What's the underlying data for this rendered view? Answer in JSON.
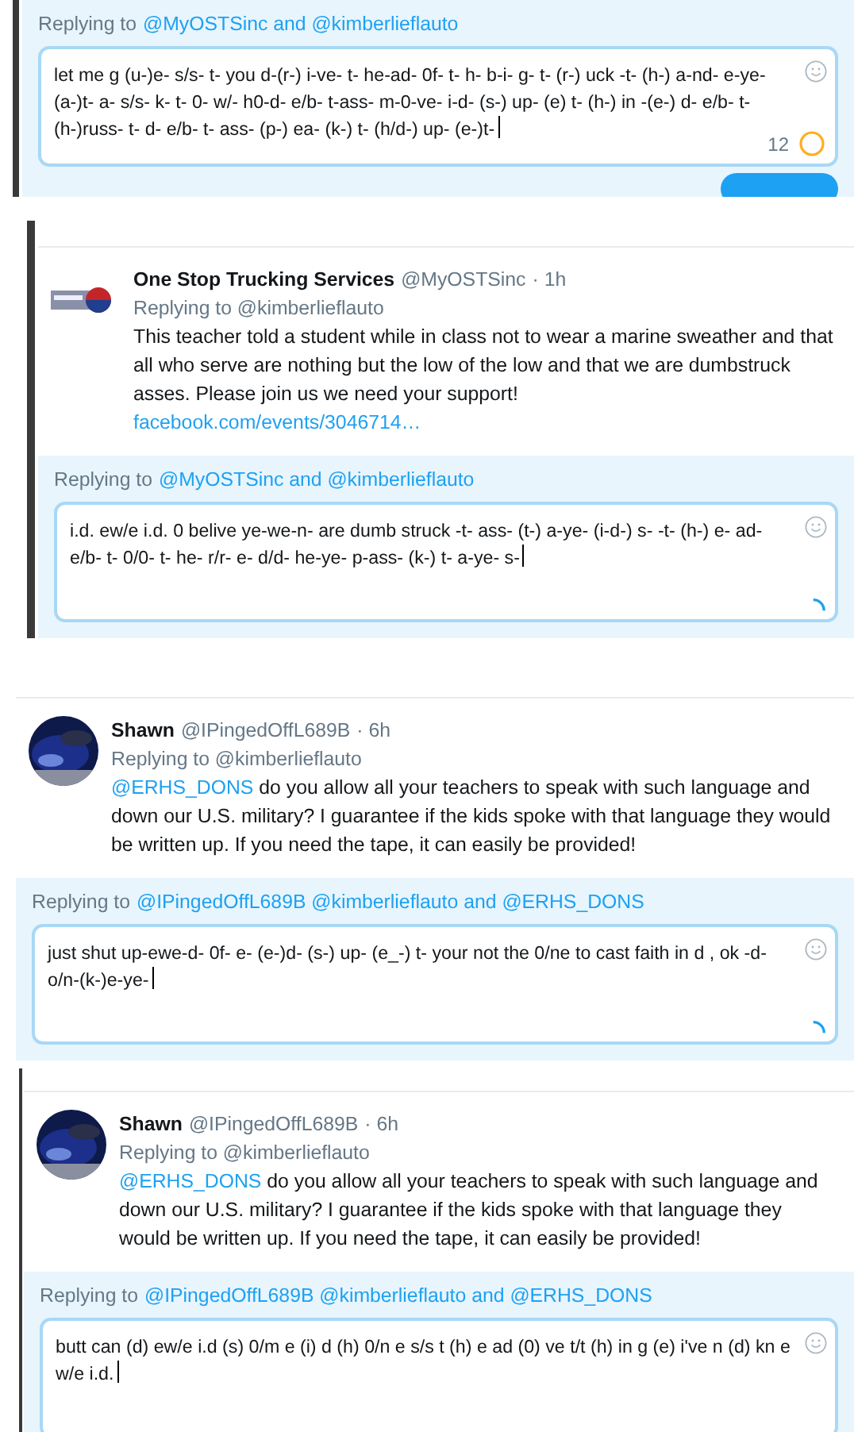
{
  "panels": [
    {
      "composer": {
        "replying_label": "Replying to",
        "replying_to": "@MyOSTSinc and @kimberlieflauto",
        "draft": "let me g (u-)e- s/s- t-  you d-(r-) i-ve- t- he-ad- 0f- t- h- b-i- g- t- (r-) uck -t- (h-) a-nd- e-ye- (a-)t- a- s/s- k- t- 0- w/- h0-d- e/b- t-ass- m-0-ve- i-d- (s-) up- (e) t- (h-) in -(e-) d- e/b- t- (h-)russ- t- d-  e/b- t- ass- (p-) ea- (k-) t- (h/d-) up- (e-)t-",
        "counter": "12",
        "indicator": {
          "kind": "ring"
        },
        "reply_button": true
      }
    },
    {
      "tweet": {
        "avatar": {
          "kind": "logo"
        },
        "name": "One Stop Trucking Services",
        "handle": "@MyOSTSinc",
        "time": "· 1h",
        "replying": "Replying to @kimberlieflauto",
        "text": "This teacher told a student while in class not to wear a marine sweather and that all who serve are nothing but the low of the low and that we are dumbstruck asses. Please join us we need your support!",
        "link": "facebook.com/events/3046714…"
      },
      "composer": {
        "replying_label": "Replying to",
        "replying_to": "@MyOSTSinc and @kimberlieflauto",
        "draft": "i.d. ew/e i.d. 0 belive ye-we-n- are dumb struck -t- ass- (t-) a-ye- (i-d-) s-  -t- (h-) e- ad- e/b- t- 0/0- t- he- r/r- e- d/d- he-ye- p-ass- (k-) t- a-ye- s-",
        "indicator": {
          "kind": "spinner"
        }
      }
    },
    {
      "tweet": {
        "name": "Shawn",
        "handle": "@IPingedOffL689B",
        "time": "· 6h",
        "replying": "Replying to @kimberlieflauto",
        "mention": "@ERHS_DONS",
        "text": "do you allow all your teachers to speak with such language and down our U.S. military? I guarantee if the kids spoke with that language they would be written up. If you need the tape, it can easily be provided!"
      },
      "composer": {
        "replying_label": "Replying to",
        "replying_to": "@IPingedOffL689B @kimberlieflauto and @ERHS_DONS",
        "draft": "just shut up-ewe-d- 0f- e- (e-)d- (s-) up- (e_-) t-   your not the 0/ne to cast faith in d , ok -d-o/n-(k-)e-ye-",
        "indicator": {
          "kind": "spinner"
        }
      }
    },
    {
      "tweet": {
        "name": "Shawn",
        "handle": "@IPingedOffL689B",
        "time": "· 6h",
        "replying": "Replying to @kimberlieflauto",
        "mention": "@ERHS_DONS",
        "text": "do you allow all your teachers to speak with such language and down our U.S. military? I guarantee if the kids spoke with that language they would be written up. If you need the tape, it can easily be provided!"
      },
      "composer": {
        "replying_label": "Replying to",
        "replying_to": "@IPingedOffL689B @kimberlieflauto and @ERHS_DONS",
        "draft": "butt can (d) ew/e i.d  (s) 0/m e (i) d (h) 0/n e s/s t (h) e ad (0) ve t/t (h) in g (e) i've n (d) kn e w/e i.d."
      }
    }
  ]
}
